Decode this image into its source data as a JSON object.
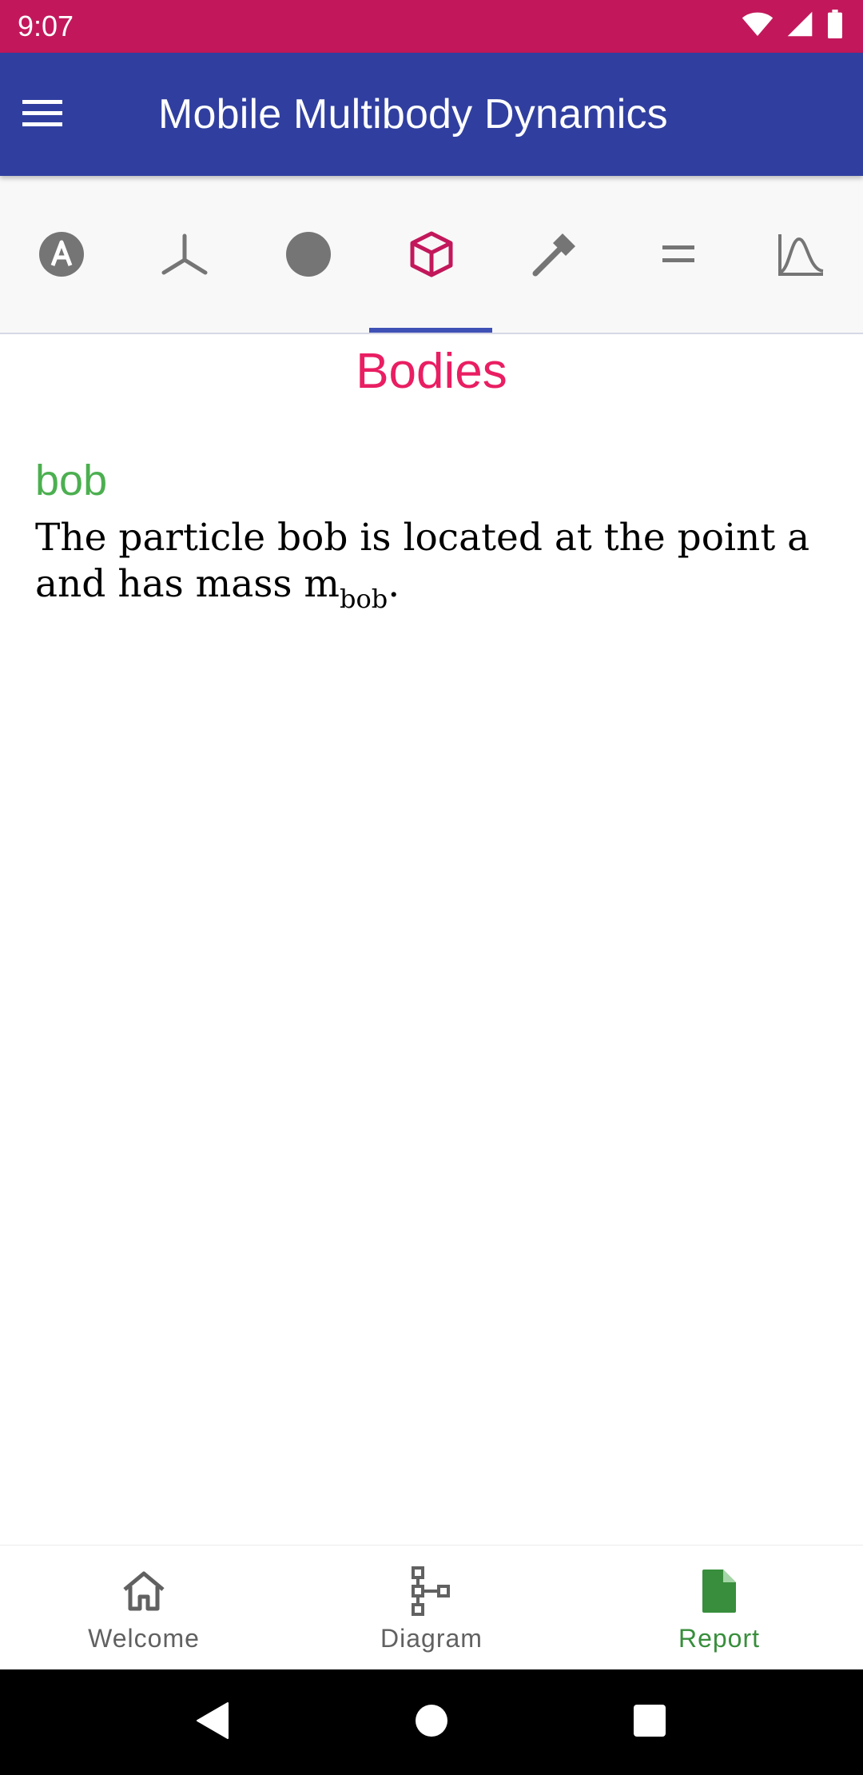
{
  "status_bar": {
    "time": "9:07",
    "icons": [
      "wifi-icon",
      "cellular-signal-icon",
      "battery-icon"
    ],
    "background": "#C2185B"
  },
  "app_bar": {
    "title": "Mobile Multibody Dynamics",
    "menu_icon": "menu-icon",
    "background": "#303F9F"
  },
  "tabs": [
    {
      "name": "tab-a",
      "icon": "circle-a-icon",
      "selected": false
    },
    {
      "name": "tab-frames",
      "icon": "axes-icon",
      "selected": false
    },
    {
      "name": "tab-points",
      "icon": "filled-circle-icon",
      "selected": false
    },
    {
      "name": "tab-bodies",
      "icon": "cube-icon",
      "selected": true
    },
    {
      "name": "tab-forces",
      "icon": "hammer-icon",
      "selected": false
    },
    {
      "name": "tab-equations",
      "icon": "equals-icon",
      "selected": false
    },
    {
      "name": "tab-plots",
      "icon": "curve-chart-icon",
      "selected": false
    }
  ],
  "content": {
    "section_title": "Bodies",
    "body": {
      "name": "bob",
      "desc_text": "The particle bob is located at the point a and has mass m",
      "desc_subscript": "bob",
      "desc_end": "."
    }
  },
  "bottom_nav": {
    "items": [
      {
        "label": "Welcome",
        "icon": "home-icon",
        "active": false
      },
      {
        "label": "Diagram",
        "icon": "diagram-icon",
        "active": false
      },
      {
        "label": "Report",
        "icon": "document-icon",
        "active": true
      }
    ]
  },
  "system_nav": {
    "back_icon": "back-triangle-icon",
    "home_icon": "home-circle-icon",
    "recents_icon": "recents-square-icon"
  },
  "colors": {
    "accent_pink": "#E91E63",
    "accent_green": "#4CAF50",
    "active_nav_green": "#388E3C",
    "tab_indicator": "#3F51B5",
    "icon_gray": "#757575"
  }
}
